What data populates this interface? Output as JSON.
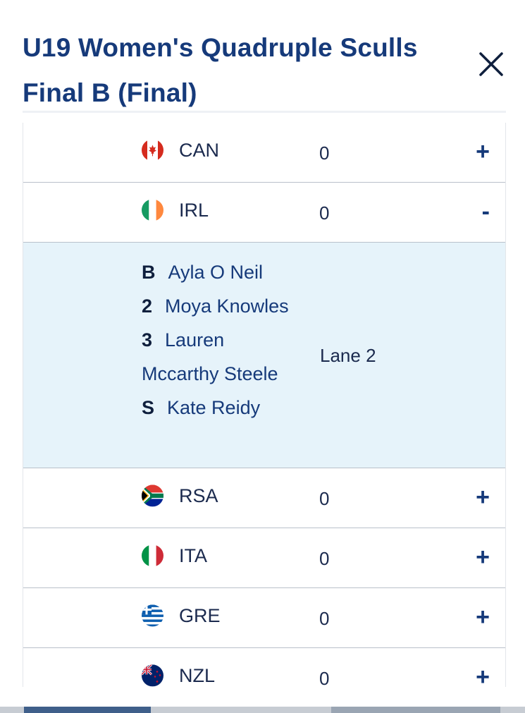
{
  "header": {
    "title": "U19 Women's Quadruple Sculls Final B (Final)",
    "close_icon": "close-icon"
  },
  "rows": [
    {
      "code": "CAN",
      "score": "0",
      "toggle": "+",
      "flag": "canada-flag-icon"
    },
    {
      "code": "IRL",
      "score": "0",
      "toggle": "-",
      "flag": "ireland-flag-icon"
    },
    {
      "code": "RSA",
      "score": "0",
      "toggle": "+",
      "flag": "south-africa-flag-icon"
    },
    {
      "code": "ITA",
      "score": "0",
      "toggle": "+",
      "flag": "italy-flag-icon"
    },
    {
      "code": "GRE",
      "score": "0",
      "toggle": "+",
      "flag": "greece-flag-icon"
    },
    {
      "code": "NZL",
      "score": "0",
      "toggle": "+",
      "flag": "new-zealand-flag-icon"
    }
  ],
  "expanded": {
    "crew": [
      {
        "seat": "B",
        "name": "Ayla O Neil"
      },
      {
        "seat": "2",
        "name": "Moya Knowles"
      },
      {
        "seat": "3",
        "name": "Lauren Mccarthy Steele"
      },
      {
        "seat": "S",
        "name": "Kate Reidy"
      }
    ],
    "lane": "Lane 2"
  },
  "colors": {
    "title": "#163a7a",
    "expanded_bg": "#e6f3fa",
    "divider": "#b9c0ca"
  }
}
